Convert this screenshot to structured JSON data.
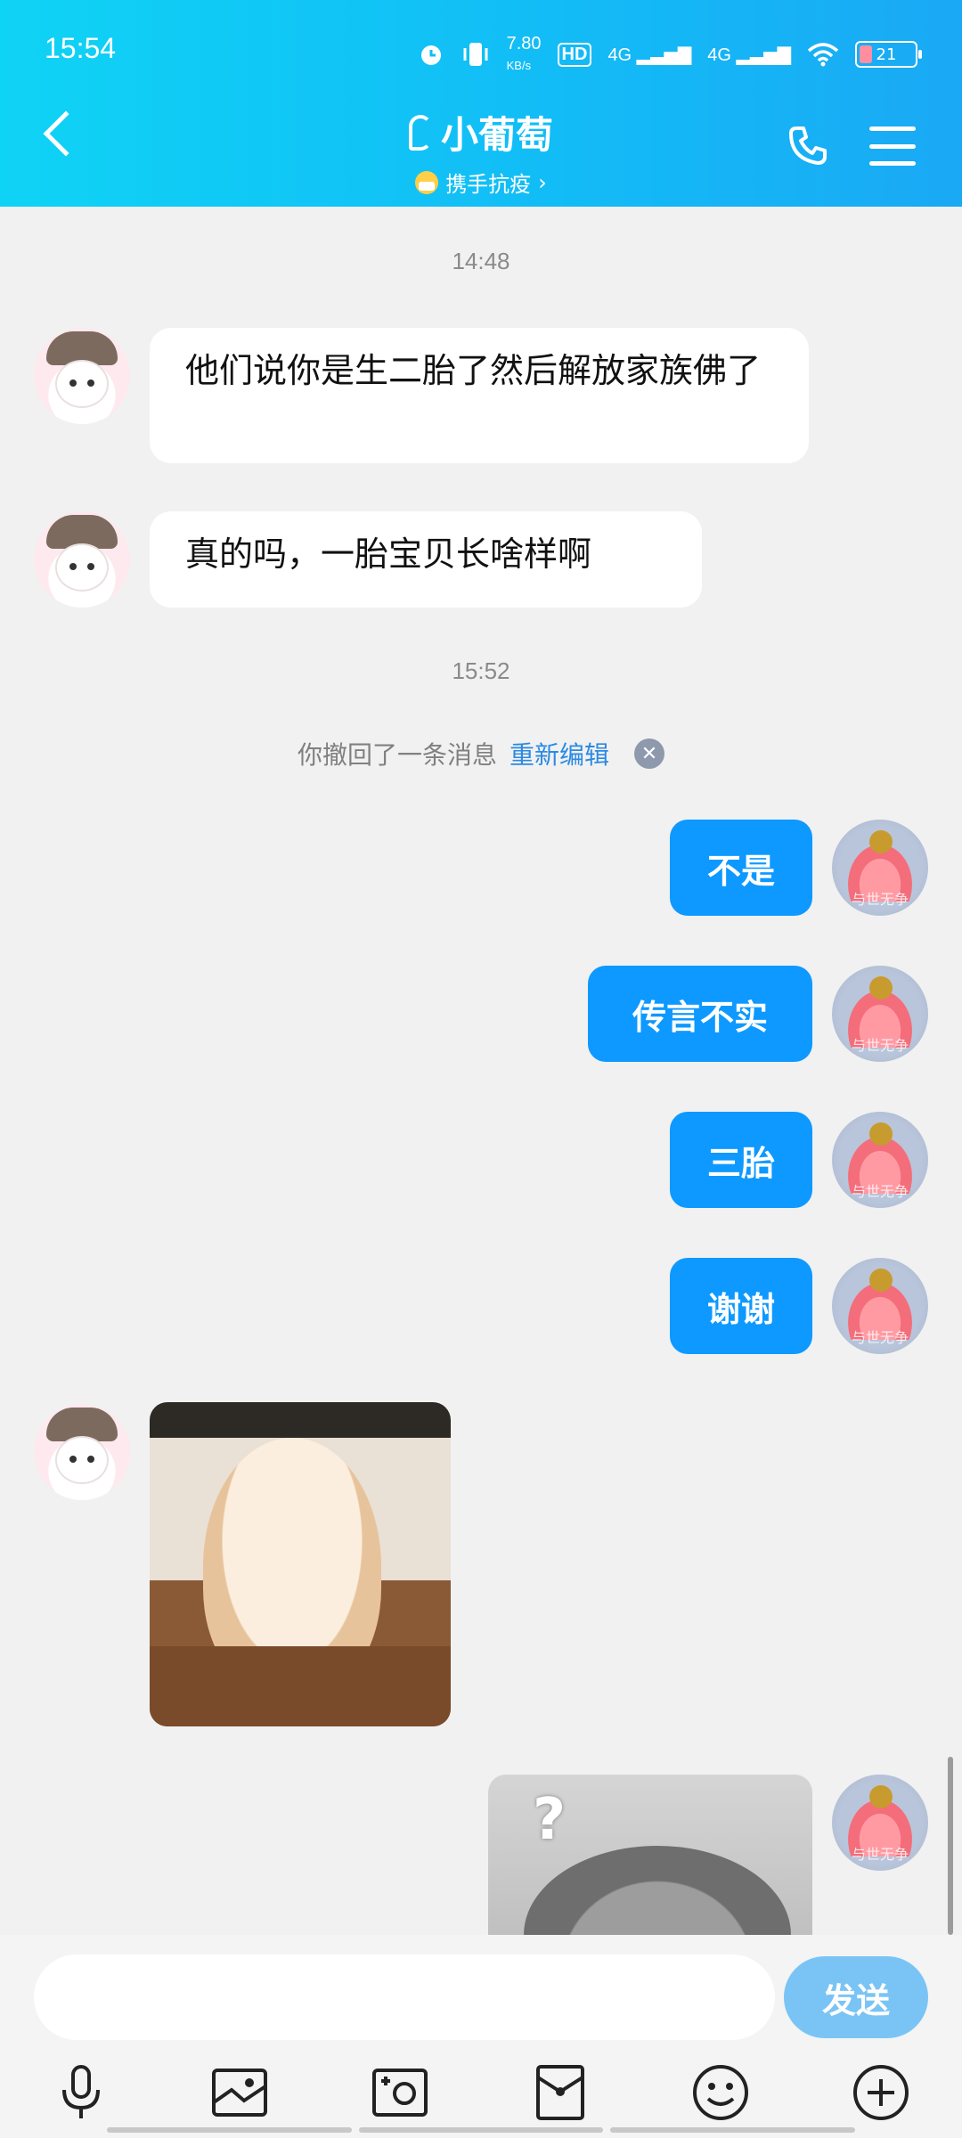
{
  "status_bar": {
    "time": "15:54",
    "speed": "7.80",
    "speed_unit": "KB/s",
    "hd": "HD",
    "net1": "4G",
    "net2": "4G",
    "battery": "21"
  },
  "header": {
    "contact_name": "小葡萄",
    "subtitle": "携手抗疫",
    "subtitle_arrow": "›",
    "bg_color": "#12bdf6"
  },
  "messages": {
    "time_1": "14:48",
    "incoming_1": "他们说你是生二胎了然后解放家族佛了",
    "incoming_2": "真的吗，一胎宝贝长啥样啊",
    "time_2": "15:52",
    "recall_text": "你撤回了一条消息",
    "recall_edit": "重新编辑",
    "recall_close": "✕",
    "outgoing_1": "不是",
    "outgoing_2": "传言不实",
    "outgoing_3": "三胎",
    "outgoing_4": "谢谢",
    "avatar_watermark": "与世无争",
    "sticker_question": "?"
  },
  "input": {
    "value": "",
    "send_label": "发送"
  },
  "toolbar": {
    "icons": [
      "microphone-icon",
      "picture-icon",
      "camera-icon",
      "red-packet-icon",
      "emoji-icon",
      "plus-icon"
    ]
  }
}
